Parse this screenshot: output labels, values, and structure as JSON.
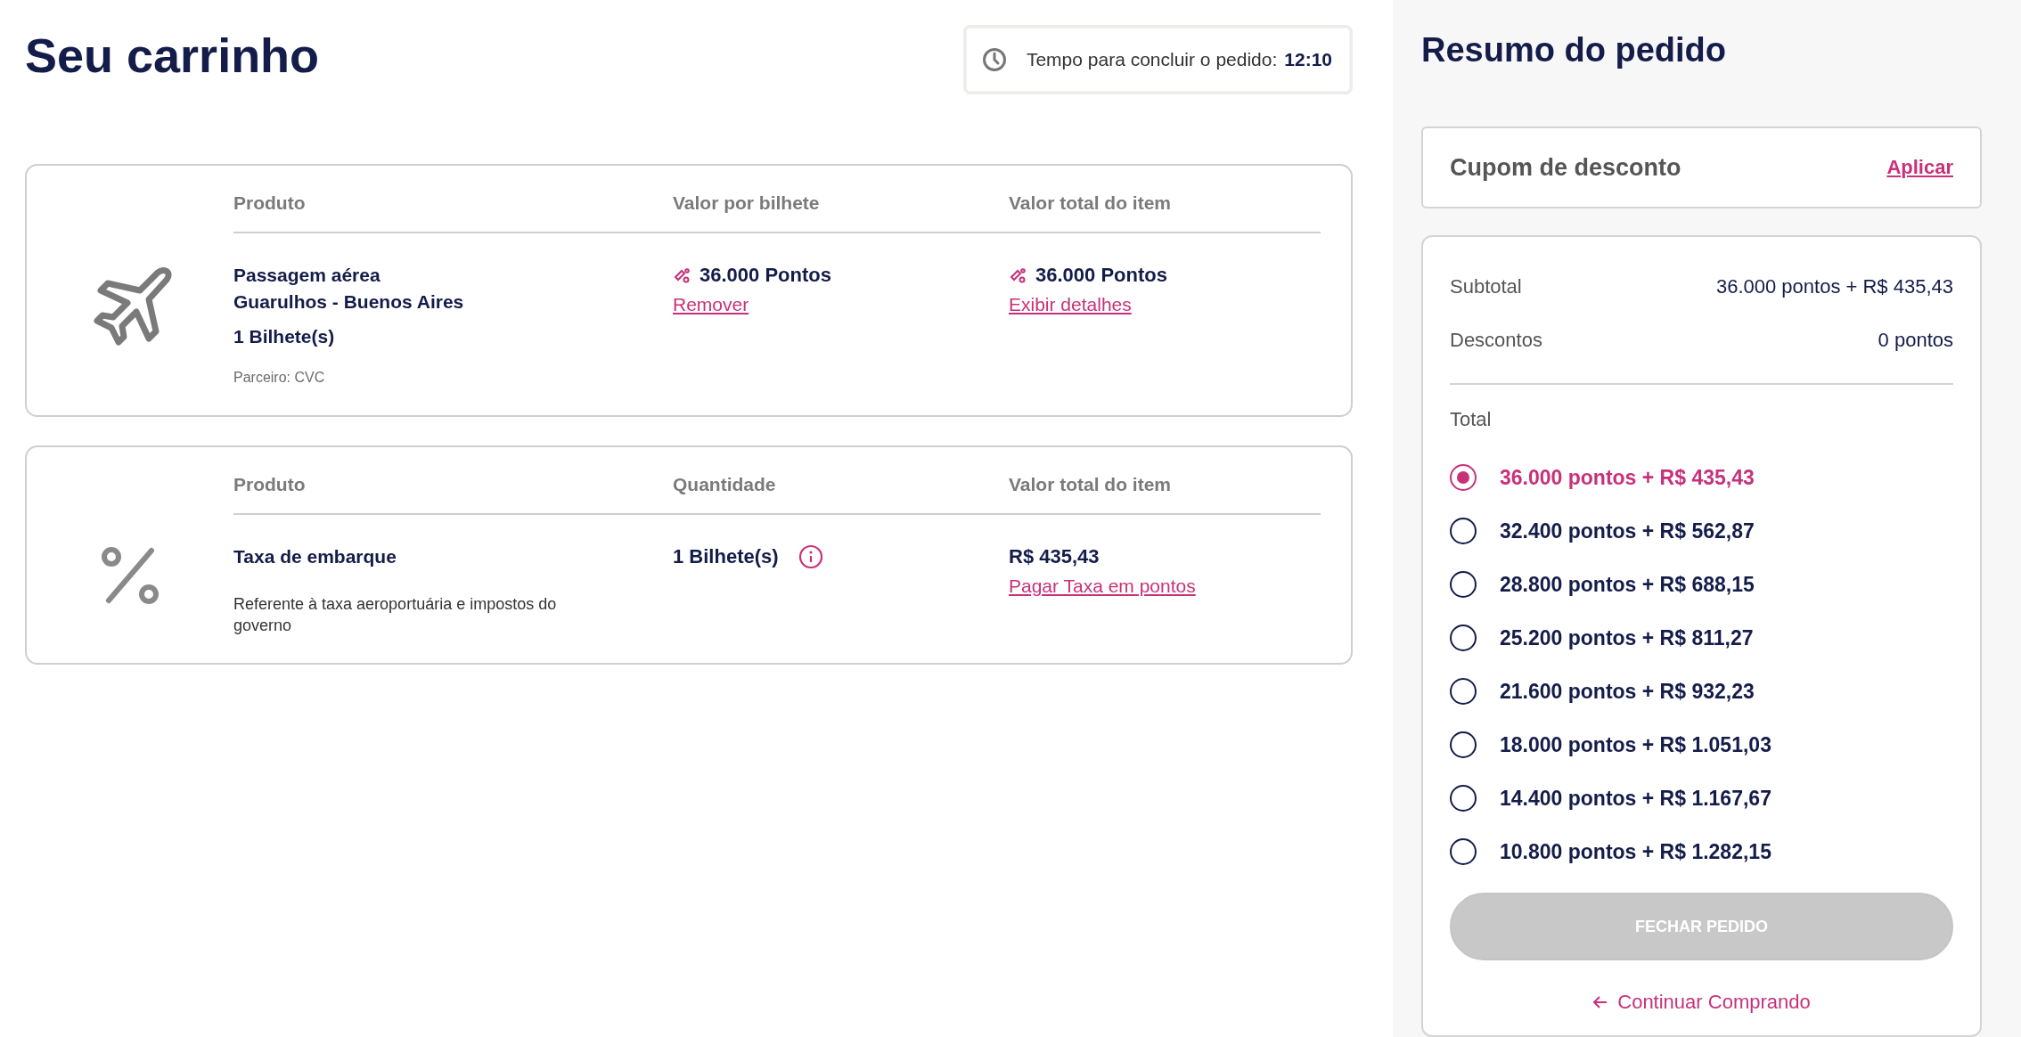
{
  "page_title": "Seu carrinho",
  "timer": {
    "label": "Tempo para concluir o pedido:",
    "time": "12:10"
  },
  "cart_items": [
    {
      "kind": "flight",
      "columns": [
        "Produto",
        "Valor por bilhete",
        "Valor total do item"
      ],
      "product": {
        "title": "Passagem aérea",
        "subtitle": "Guarulhos - Buenos Aires",
        "quantity": "1 Bilhete(s)",
        "note": "Parceiro: CVC"
      },
      "middle": {
        "kind": "points",
        "value": "36.000 Pontos",
        "link": "Remover"
      },
      "total": {
        "kind": "points",
        "value": "36.000 Pontos",
        "link": "Exibir detalhes"
      }
    },
    {
      "kind": "fee",
      "columns": [
        "Produto",
        "Quantidade",
        "Valor total do item"
      ],
      "product": {
        "title": "Taxa de embarque",
        "note": "Referente à taxa aeroportuária e impostos do governo"
      },
      "middle": {
        "kind": "quantity",
        "value": "1 Bilhete(s)"
      },
      "total": {
        "kind": "money",
        "value": "R$ 435,43",
        "link": "Pagar Taxa em pontos"
      }
    }
  ],
  "summary": {
    "title": "Resumo do pedido",
    "coupon": {
      "label": "Cupom de desconto",
      "action": "Aplicar"
    },
    "rows": [
      {
        "label": "Subtotal",
        "value": "36.000 pontos + R$ 435,43"
      },
      {
        "label": "Descontos",
        "value": "0 pontos"
      }
    ],
    "total_label": "Total",
    "options": [
      {
        "label": "36.000 pontos + R$ 435,43",
        "selected": true
      },
      {
        "label": "32.400 pontos + R$ 562,87",
        "selected": false
      },
      {
        "label": "28.800 pontos + R$ 688,15",
        "selected": false
      },
      {
        "label": "25.200 pontos + R$ 811,27",
        "selected": false
      },
      {
        "label": "21.600 pontos + R$ 932,23",
        "selected": false
      },
      {
        "label": "18.000 pontos + R$ 1.051,03",
        "selected": false
      },
      {
        "label": "14.400 pontos + R$ 1.167,67",
        "selected": false
      },
      {
        "label": "10.800 pontos + R$ 1.282,15",
        "selected": false
      }
    ],
    "checkout": {
      "label": "FECHAR PEDIDO",
      "disabled": true
    },
    "continue_link": "Continuar Comprando"
  }
}
